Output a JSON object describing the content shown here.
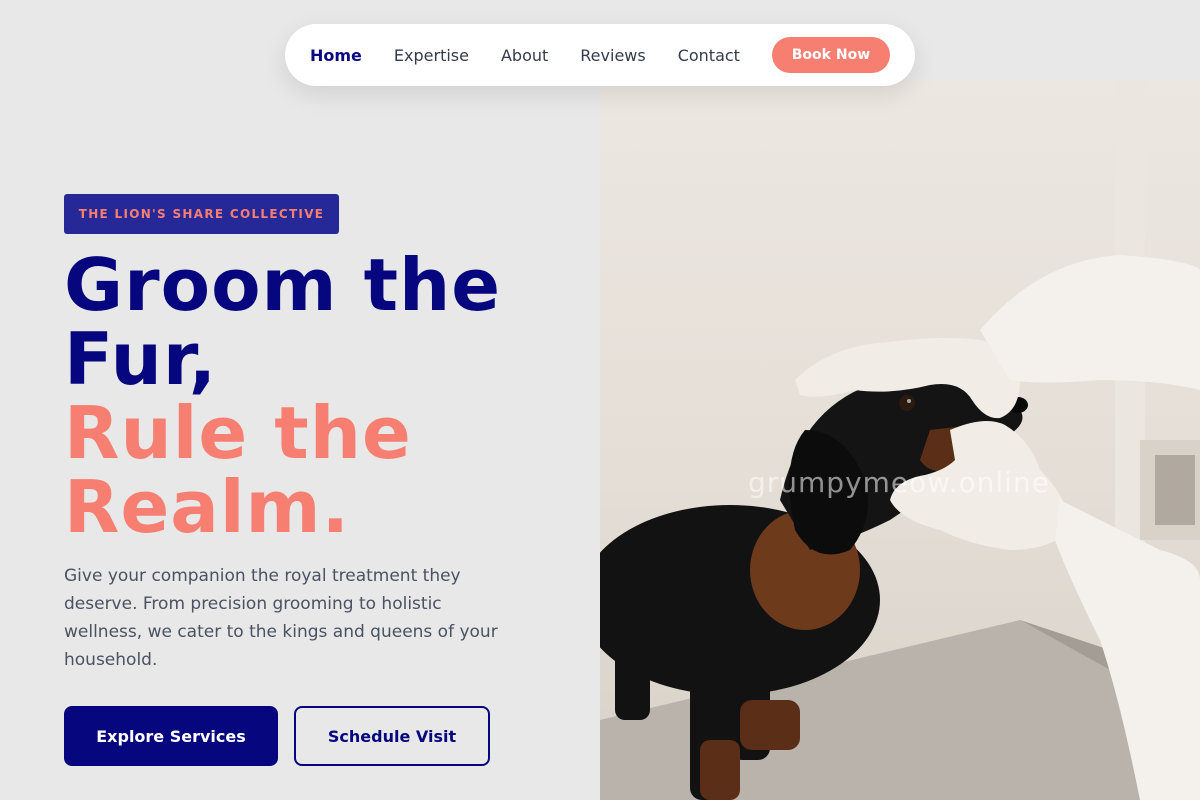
{
  "nav": {
    "links": [
      "Home",
      "Expertise",
      "About",
      "Reviews",
      "Contact"
    ],
    "cta": "Book Now"
  },
  "hero": {
    "badge": "THE LION'S SHARE COLLECTIVE",
    "headline_line1": "Groom the",
    "headline_line2": "Fur,",
    "headline_line3": "Rule the",
    "headline_line4": "Realm.",
    "description": "Give your companion the royal treatment they deserve. From precision grooming to holistic wellness, we cater to the kings and queens of your household.",
    "primary_button": "Explore Services",
    "secondary_button": "Schedule Visit"
  },
  "photo": {
    "watermark": "grumpymeow.online"
  },
  "colors": {
    "navy": "#06067f",
    "coral": "#f77f72",
    "badge_bg": "#272898",
    "page_bg": "#e8e8e8"
  }
}
